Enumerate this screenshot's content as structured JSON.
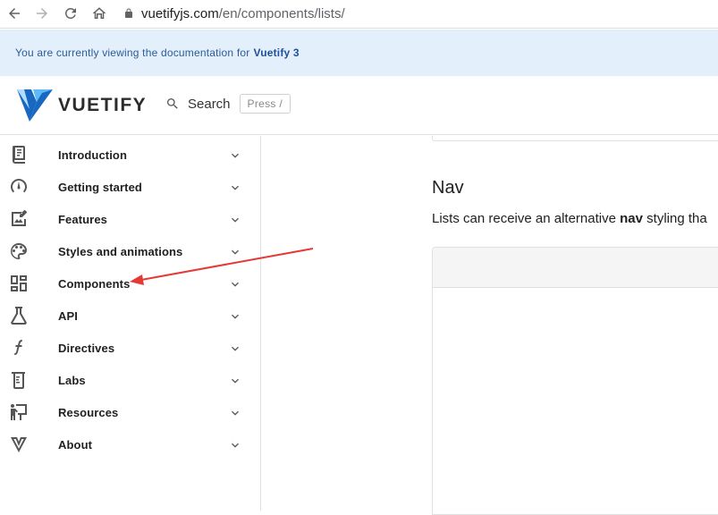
{
  "browser": {
    "url_domain": "vuetifyjs.com",
    "url_path": "/en/components/lists/",
    "icons": [
      "back-icon",
      "forward-icon",
      "reload-icon",
      "home-icon",
      "lock-icon"
    ]
  },
  "banner": {
    "text": "You are currently viewing the documentation for",
    "highlight": "Vuetify 3"
  },
  "appbar": {
    "brand": "VUETIFY",
    "search_label": "Search",
    "search_hint": "Press /"
  },
  "sidebar": {
    "items": [
      {
        "label": "Introduction",
        "icon": "book-icon"
      },
      {
        "label": "Getting started",
        "icon": "speedometer-icon"
      },
      {
        "label": "Features",
        "icon": "image-edit-icon"
      },
      {
        "label": "Styles and animations",
        "icon": "palette-icon"
      },
      {
        "label": "Components",
        "icon": "view-dashboard-icon"
      },
      {
        "label": "API",
        "icon": "flask-icon"
      },
      {
        "label": "Directives",
        "icon": "function-icon"
      },
      {
        "label": "Labs",
        "icon": "beaker-icon"
      },
      {
        "label": "Resources",
        "icon": "presenter-icon"
      },
      {
        "label": "About",
        "icon": "vuetify-icon"
      }
    ]
  },
  "main": {
    "section_title": "Nav",
    "section_text_before": "Lists can receive an alternative ",
    "section_text_bold": "nav",
    "section_text_after": " styling tha"
  },
  "colors": {
    "banner_bg": "#e3f0fb",
    "banner_text": "#2b5b9a",
    "logo_blue_dark": "#1867c0",
    "logo_blue_light": "#5cbbf6",
    "annotation_arrow": "#e53935"
  }
}
